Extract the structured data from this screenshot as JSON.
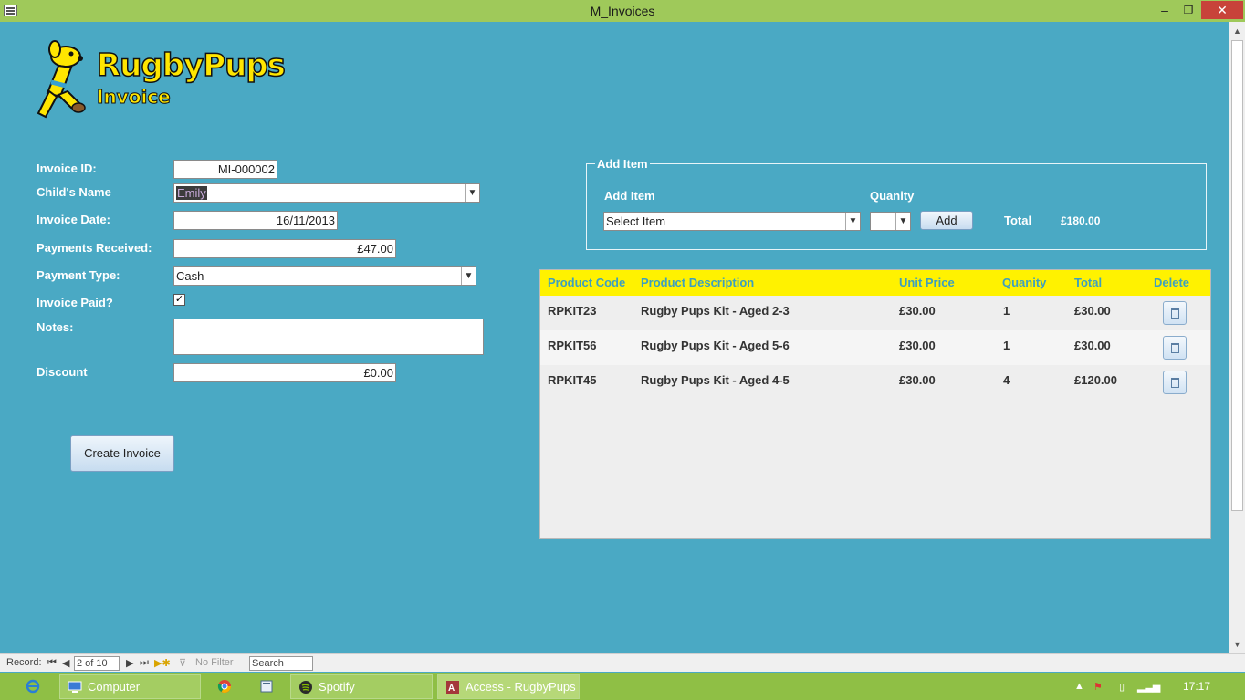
{
  "window": {
    "title": "M_Invoices",
    "min_glyph": "–",
    "max_glyph": "❐",
    "close_glyph": "✕"
  },
  "logo": {
    "line1": "RugbyPups",
    "line2": "Invoice"
  },
  "form": {
    "invoice_id": {
      "label": "Invoice ID:",
      "value": "MI-000002"
    },
    "childs_name": {
      "label": "Child's Name",
      "value": "Emily"
    },
    "invoice_date": {
      "label": "Invoice Date:",
      "value": "16/11/2013"
    },
    "payments_received": {
      "label": "Payments Received:",
      "value": "£47.00"
    },
    "payment_type": {
      "label": "Payment Type:",
      "value": "Cash"
    },
    "invoice_paid": {
      "label": "Invoice Paid?",
      "checked": true,
      "glyph": "✓"
    },
    "notes": {
      "label": "Notes:",
      "value": ""
    },
    "discount": {
      "label": "Discount",
      "value": "£0.00"
    },
    "create_button": "Create Invoice"
  },
  "add_item": {
    "group_title": "Add Item",
    "item_label": "Add Item",
    "item_value": "Select Item",
    "quantity_label": "Quanity",
    "quantity_value": "",
    "add_button": "Add",
    "total_label": "Total",
    "total_value": "£180.00"
  },
  "table": {
    "headers": [
      "Product Code",
      "Product Description",
      "Unit Price",
      "Quanity",
      "Total",
      "Delete"
    ],
    "rows": [
      {
        "code": "RPKIT23",
        "description": "Rugby Pups Kit - Aged 2-3",
        "unit_price": "£30.00",
        "quantity": "1",
        "total": "£30.00"
      },
      {
        "code": "RPKIT56",
        "description": "Rugby Pups Kit - Aged 5-6",
        "unit_price": "£30.00",
        "quantity": "1",
        "total": "£30.00"
      },
      {
        "code": "RPKIT45",
        "description": "Rugby Pups Kit - Aged 4-5",
        "unit_price": "£30.00",
        "quantity": "4",
        "total": "£120.00"
      }
    ]
  },
  "record_nav": {
    "label": "Record:",
    "current": "2 of 10",
    "filter": "No Filter",
    "search": "Search"
  },
  "taskbar": {
    "items": [
      "Computer",
      "Spotify",
      "Access - RugbyPups ..."
    ],
    "clock": "17:17"
  },
  "colors": {
    "background": "#4aa9c4",
    "titlebar": "#9fc95a",
    "table_header": "#fff200",
    "header_text": "#3d9fbf"
  }
}
